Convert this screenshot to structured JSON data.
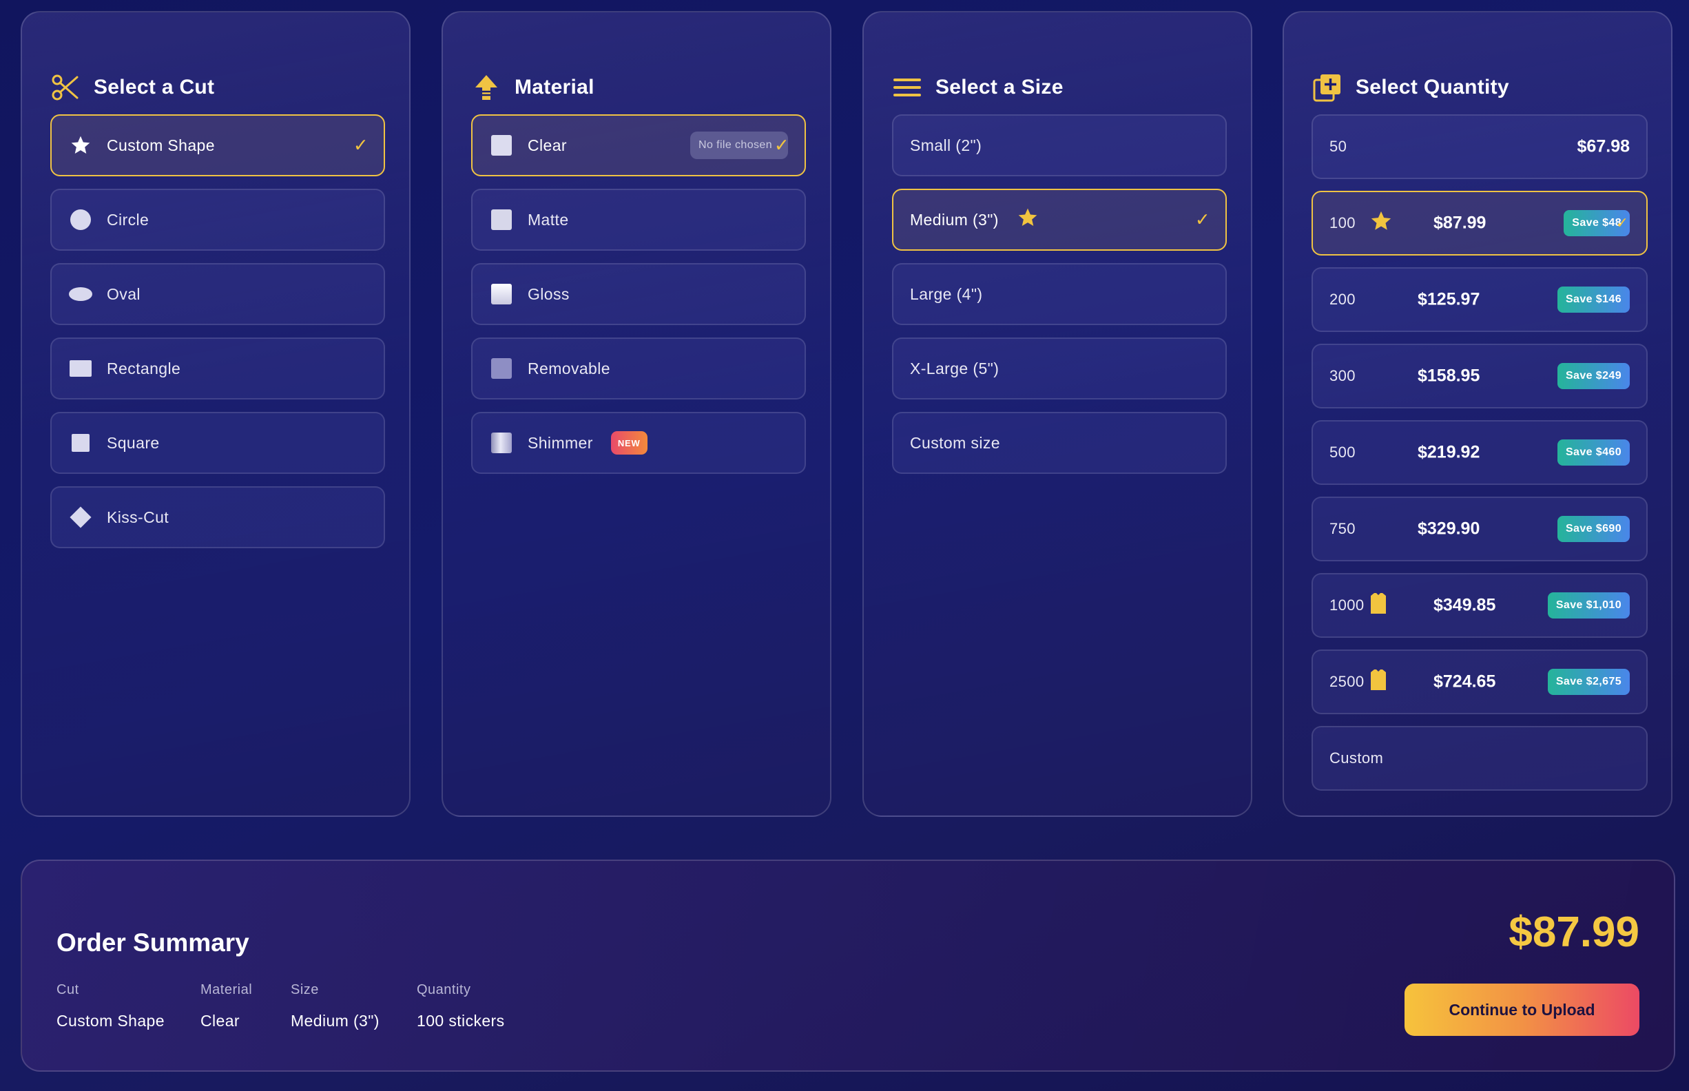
{
  "cut_panel": {
    "title": "Select a Cut",
    "icon": "scissors-icon",
    "options": [
      {
        "label": "Custom Shape",
        "icon": "star-icon",
        "selected": true
      },
      {
        "label": "Circle",
        "icon": "circle-shape-icon",
        "selected": false
      },
      {
        "label": "Oval",
        "icon": "oval-shape-icon",
        "selected": false
      },
      {
        "label": "Rectangle",
        "icon": "rectangle-shape-icon",
        "selected": false
      },
      {
        "label": "Square",
        "icon": "square-shape-icon",
        "selected": false
      },
      {
        "label": "Kiss-Cut",
        "icon": "diamond-shape-icon",
        "selected": false
      }
    ]
  },
  "material_panel": {
    "title": "Material",
    "icon": "material-layers-icon",
    "options": [
      {
        "label": "Clear",
        "selected": true,
        "file_chip": "No file chosen"
      },
      {
        "label": "Matte",
        "selected": false
      },
      {
        "label": "Gloss",
        "selected": false
      },
      {
        "label": "Removable",
        "selected": false
      },
      {
        "label": "Shimmer",
        "selected": false,
        "badge": "NEW"
      }
    ]
  },
  "size_panel": {
    "title": "Select a Size",
    "icon": "lines-icon",
    "options": [
      {
        "label": "Small (2\")",
        "selected": false
      },
      {
        "label": "Medium (3\")",
        "selected": true,
        "popular": true
      },
      {
        "label": "Large (4\")",
        "selected": false
      },
      {
        "label": "X-Large (5\")",
        "selected": false
      },
      {
        "label": "Custom size",
        "selected": false
      }
    ]
  },
  "quantity_panel": {
    "title": "Select Quantity",
    "icon": "add-copies-icon",
    "options": [
      {
        "qty": "50",
        "price": "$67.98",
        "save": null,
        "selected": false
      },
      {
        "qty": "100",
        "price": "$87.99",
        "save": "Save $48",
        "selected": true,
        "badge_icon": "star-icon"
      },
      {
        "qty": "200",
        "price": "$125.97",
        "save": "Save $146",
        "selected": false
      },
      {
        "qty": "300",
        "price": "$158.95",
        "save": "Save $249",
        "selected": false
      },
      {
        "qty": "500",
        "price": "$219.92",
        "save": "Save $460",
        "selected": false
      },
      {
        "qty": "750",
        "price": "$329.90",
        "save": "Save $690",
        "selected": false
      },
      {
        "qty": "1000",
        "price": "$349.85",
        "save": "Save $1,010",
        "selected": false,
        "badge_icon": "shirt-icon"
      },
      {
        "qty": "2500",
        "price": "$724.65",
        "save": "Save $2,675",
        "selected": false,
        "badge_icon": "shirt-icon"
      },
      {
        "qty": "Custom",
        "price": null,
        "save": null,
        "selected": false
      }
    ]
  },
  "summary": {
    "title": "Order Summary",
    "total": "$87.99",
    "button_label": "Continue to Upload",
    "fields": [
      {
        "label": "Cut",
        "value": "Custom Shape"
      },
      {
        "label": "Material",
        "value": "Clear"
      },
      {
        "label": "Size",
        "value": "Medium (3\")"
      },
      {
        "label": "Quantity",
        "value": "100 stickers"
      }
    ]
  },
  "colors": {
    "accent_gold": "#f0c343",
    "background": "#141a6a",
    "save_badge_gradient": [
      "#25b49a",
      "#4a86ea"
    ],
    "button_gradient": [
      "#f6c33c",
      "#ec4a64"
    ]
  }
}
